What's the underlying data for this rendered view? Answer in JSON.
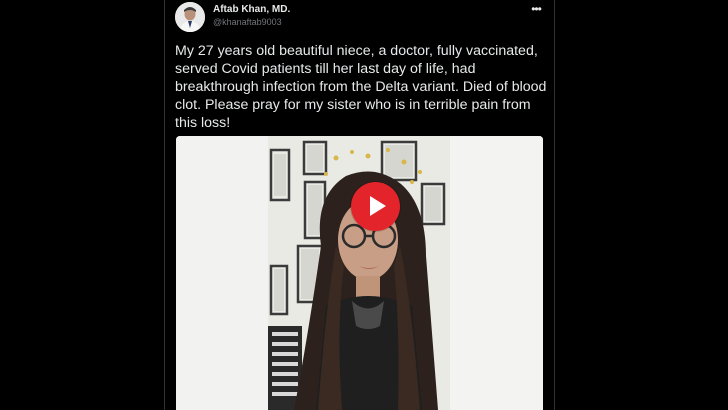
{
  "tweet": {
    "author_name": "Aftab Khan, MD.",
    "author_handle": "@khanaftab9003",
    "text": "My 27 years old beautiful niece, a doctor, fully vaccinated, served Covid patients till her last day of life, had breakthrough infection from the Delta variant. Died of blood clot. Please pray for my sister who is in terrible pain from this loss!",
    "more_icon": "more-horizontal-icon",
    "avatar_icon": "avatar",
    "media": {
      "play_icon": "play-icon",
      "play_color": "#e3242b"
    }
  }
}
